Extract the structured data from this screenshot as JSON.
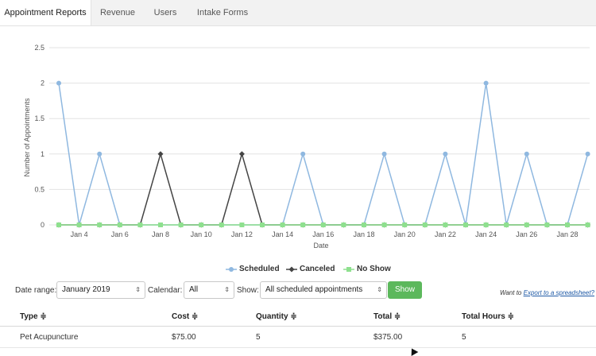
{
  "tabs": [
    {
      "label": "Appointment Reports",
      "active": true
    },
    {
      "label": "Revenue",
      "active": false
    },
    {
      "label": "Users",
      "active": false
    },
    {
      "label": "Intake Forms",
      "active": false
    }
  ],
  "chart_data": {
    "type": "line",
    "xlabel": "Date",
    "ylabel": "Number of Appointments",
    "ylim": [
      0,
      2.5
    ],
    "yticks": [
      "0",
      "0.5",
      "1",
      "1.5",
      "2",
      "2.5"
    ],
    "x": [
      "Jan 3",
      "Jan 4",
      "Jan 5",
      "Jan 6",
      "Jan 7",
      "Jan 8",
      "Jan 9",
      "Jan 10",
      "Jan 11",
      "Jan 12",
      "Jan 13",
      "Jan 14",
      "Jan 15",
      "Jan 16",
      "Jan 17",
      "Jan 18",
      "Jan 19",
      "Jan 20",
      "Jan 21",
      "Jan 22",
      "Jan 23",
      "Jan 24",
      "Jan 25",
      "Jan 26",
      "Jan 27",
      "Jan 28",
      "Jan 29"
    ],
    "xtick_labels": [
      "Jan 4",
      "Jan 6",
      "Jan 8",
      "Jan 10",
      "Jan 12",
      "Jan 14",
      "Jan 16",
      "Jan 18",
      "Jan 20",
      "Jan 22",
      "Jan 24",
      "Jan 26",
      "Jan 28"
    ],
    "grid": true,
    "legend_position": "bottom",
    "series": [
      {
        "name": "Scheduled",
        "color": "#8fb8e0",
        "marker": "circle",
        "values": [
          2,
          0,
          1,
          0,
          0,
          0,
          0,
          0,
          0,
          0,
          0,
          0,
          1,
          0,
          0,
          0,
          1,
          0,
          0,
          1,
          0,
          2,
          0,
          1,
          0,
          0,
          1
        ]
      },
      {
        "name": "Canceled",
        "color": "#444444",
        "marker": "diamond",
        "values": [
          0,
          0,
          0,
          0,
          0,
          1,
          0,
          0,
          0,
          1,
          0,
          0,
          0,
          0,
          0,
          0,
          0,
          0,
          0,
          0,
          0,
          0,
          0,
          0,
          0,
          0,
          0
        ]
      },
      {
        "name": "No Show",
        "color": "#8ee08e",
        "marker": "square",
        "values": [
          0,
          0,
          0,
          0,
          0,
          0,
          0,
          0,
          0,
          0,
          0,
          0,
          0,
          0,
          0,
          0,
          0,
          0,
          0,
          0,
          0,
          0,
          0,
          0,
          0,
          0,
          0
        ]
      }
    ]
  },
  "controls": {
    "date_range_label": "Date range:",
    "date_range_value": "January 2019",
    "calendar_label": "Calendar:",
    "calendar_value": "All",
    "show_label": "Show:",
    "show_value": "All scheduled appointments",
    "show_button": "Show",
    "export_prefix": "Want to ",
    "export_link": "Export to a spreadsheet?"
  },
  "table": {
    "headers": [
      "Type ≑",
      "Cost ≑",
      "Quantity ≑",
      "Total ≑",
      "Total Hours ≑"
    ],
    "rows": [
      [
        "Pet Acupuncture",
        "$75.00",
        "5",
        "$375.00",
        "5"
      ]
    ]
  },
  "icons": {
    "select_arrow": "⇕"
  }
}
